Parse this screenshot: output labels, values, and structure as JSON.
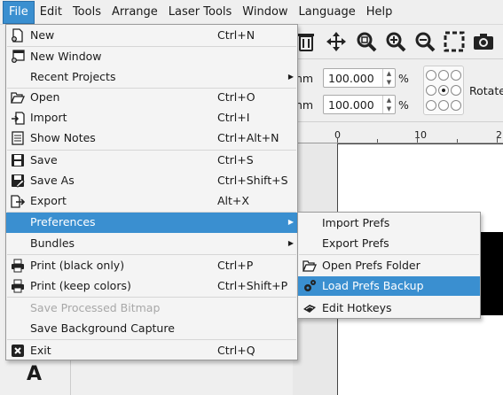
{
  "menubar": {
    "items": [
      {
        "label": "File"
      },
      {
        "label": "Edit"
      },
      {
        "label": "Tools"
      },
      {
        "label": "Arrange"
      },
      {
        "label": "Laser Tools"
      },
      {
        "label": "Window"
      },
      {
        "label": "Language"
      },
      {
        "label": "Help"
      }
    ]
  },
  "file_menu": {
    "items": [
      {
        "label": "New",
        "shortcut": "Ctrl+N",
        "icon": "new-file-icon"
      },
      {
        "label": "New Window",
        "shortcut": "",
        "icon": "new-window-icon"
      },
      {
        "label": "Recent Projects",
        "shortcut": "",
        "submenu": true
      },
      {
        "label": "Open",
        "shortcut": "Ctrl+O",
        "icon": "folder-open-icon"
      },
      {
        "label": "Import",
        "shortcut": "Ctrl+I",
        "icon": "import-icon"
      },
      {
        "label": "Show Notes",
        "shortcut": "Ctrl+Alt+N",
        "icon": "notes-icon"
      },
      {
        "label": "Save",
        "shortcut": "Ctrl+S",
        "icon": "save-icon"
      },
      {
        "label": "Save As",
        "shortcut": "Ctrl+Shift+S",
        "icon": "save-as-icon"
      },
      {
        "label": "Export",
        "shortcut": "Alt+X",
        "icon": "export-icon"
      },
      {
        "label": "Preferences",
        "shortcut": "",
        "submenu": true,
        "highlighted": true
      },
      {
        "label": "Bundles",
        "shortcut": "",
        "submenu": true
      },
      {
        "label": "Print (black only)",
        "shortcut": "Ctrl+P",
        "icon": "printer-icon"
      },
      {
        "label": "Print (keep colors)",
        "shortcut": "Ctrl+Shift+P",
        "icon": "printer-color-icon"
      },
      {
        "label": "Save Processed Bitmap",
        "shortcut": "",
        "disabled": true
      },
      {
        "label": "Save Background Capture",
        "shortcut": ""
      },
      {
        "label": "Exit",
        "shortcut": "Ctrl+Q",
        "icon": "exit-icon"
      }
    ]
  },
  "prefs_submenu": {
    "items": [
      {
        "label": "Import Prefs"
      },
      {
        "label": "Export Prefs"
      },
      {
        "label": "Open Prefs Folder",
        "icon": "folder-open-icon"
      },
      {
        "label": "Load Prefs Backup",
        "icon": "gears-icon",
        "highlighted": true
      },
      {
        "label": "Edit Hotkeys",
        "icon": "keyboard-icon"
      }
    ]
  },
  "properties": {
    "unit_1": "nm",
    "width_value": "100.000",
    "pct_1": "%",
    "unit_2": "nm",
    "height_value": "100.000",
    "pct_2": "%",
    "rotate_label": "Rotate"
  },
  "ruler": {
    "labels": [
      "0",
      "10",
      "2"
    ]
  },
  "tool_text": "A",
  "colors": {
    "accent": "#3a8fd0",
    "menu_bg": "#f4f4f4",
    "window_bg": "#efefef"
  }
}
